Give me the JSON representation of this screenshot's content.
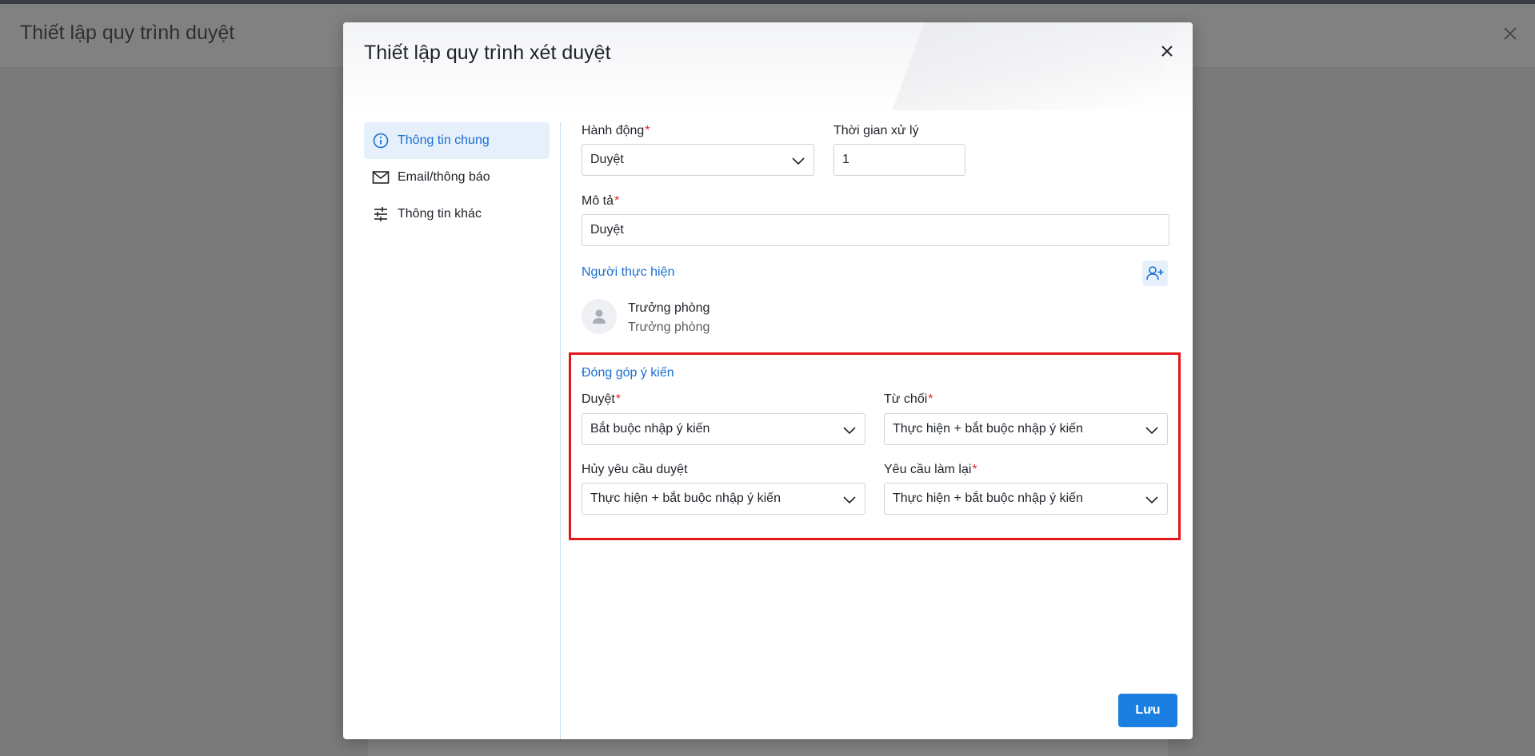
{
  "background": {
    "page_title": "Thiết lập quy trình duyệt"
  },
  "modal": {
    "title": "Thiết lập quy trình xét duyệt",
    "nav": [
      {
        "label": "Thông tin chung",
        "icon": "info-circle-icon",
        "active": true
      },
      {
        "label": "Email/thông báo",
        "icon": "mail-icon",
        "active": false
      },
      {
        "label": "Thông tin khác",
        "icon": "sliders-icon",
        "active": false
      }
    ],
    "form": {
      "action_label": "Hành động",
      "action_value": "Duyệt",
      "time_label": "Thời gian xử lý",
      "time_value": "1",
      "description_label": "Mô tả",
      "description_value": "Duyệt",
      "performer_section": "Người thực hiện",
      "performer_name": "Trưởng phòng",
      "performer_role": "Trưởng phòng",
      "feedback_section": "Đóng góp ý kiến",
      "approve_label": "Duyệt",
      "approve_value": "Bắt buộc nhập ý kiến",
      "reject_label": "Từ chối",
      "reject_value": "Thực hiện + bắt buộc nhập ý kiến",
      "cancel_label": "Hủy yêu cầu duyệt",
      "cancel_value": "Thực hiện + bắt buộc nhập ý kiến",
      "redo_label": "Yêu cầu làm lại",
      "redo_value": "Thực hiện + bắt buộc nhập ý kiến"
    },
    "save_label": "Lưu"
  },
  "colors": {
    "accent": "#1a7fe0",
    "link": "#1a6fd1",
    "required": "#e0282e",
    "highlight": "#e4161c"
  }
}
